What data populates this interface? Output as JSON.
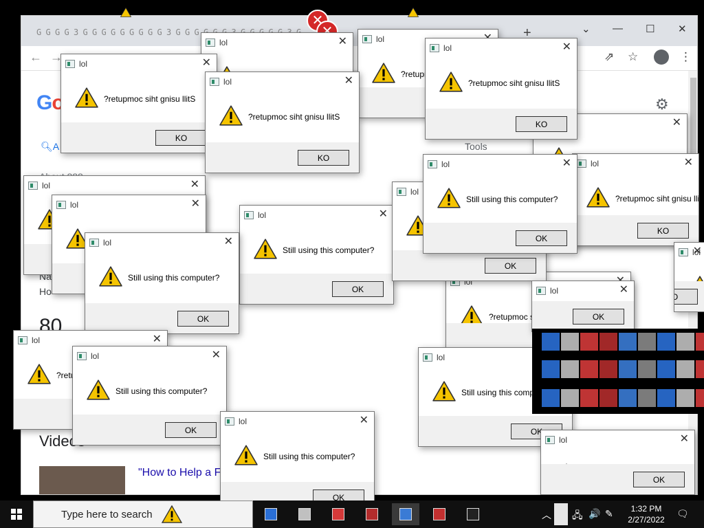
{
  "browser": {
    "tab_glyphs": [
      "G",
      "G",
      "G",
      "G",
      "3",
      "G",
      "G",
      "G",
      "G",
      "G",
      "G",
      "G",
      "G",
      "G",
      "3",
      "G",
      "G",
      "G",
      "G",
      "G",
      "G",
      "3",
      "G",
      "G",
      "G",
      "G",
      "G",
      "3",
      "G"
    ],
    "new_tab_glyph": "+",
    "minimize_glyph": "—",
    "maximize_glyph": "☐",
    "close_glyph": "✕",
    "back_glyph": "←",
    "forward_glyph": "→",
    "share_glyph": "⇗",
    "bookmark_glyph": "☆",
    "menu_glyph": "⋮",
    "logo_letters": [
      "G",
      "o"
    ],
    "search_tab_all": "A",
    "result_count": "About 888",
    "tools_label": "Tools",
    "snippet_ho": "Ho",
    "snippet_na": "Na",
    "big_number": "80",
    "videos_heading": "Videos",
    "video_title": "\"How to Help a Fr",
    "gear_glyph": "⚙"
  },
  "dialogs": [
    {
      "title": "lol",
      "message": "?retupmoc siht gnisu llitS",
      "button": "KO"
    },
    {
      "title": "lol",
      "message": "?retupmoc siht gnisu llitS",
      "button": "KO"
    },
    {
      "title": "lol",
      "message": "?retupmoc siht gnisu llitS",
      "button": "KO"
    },
    {
      "title": "lol",
      "message": "?retupmoc siht gnisu llitS",
      "button": "KO"
    },
    {
      "title": "lol",
      "message": "Still using this computer?",
      "button": "OK"
    },
    {
      "title": "lol",
      "message": "Still using this computer?",
      "button": "OK"
    },
    {
      "title": "lol",
      "message": "Still using this computer?",
      "button": "OK"
    },
    {
      "title": "lol",
      "message": "Still using this computer?",
      "button": "OK"
    },
    {
      "title": "lol",
      "message": "Still using this computer?",
      "button": "OK"
    },
    {
      "title": "lol",
      "message": "Still using this computer?",
      "button": "OK"
    },
    {
      "title": "lol",
      "message": "?retupmoc s",
      "button": "KO"
    },
    {
      "title": "lol",
      "message": "?retu",
      "button": "KO"
    }
  ],
  "close_glyph": "✕",
  "error_glyph": "✕",
  "taskbar": {
    "search_placeholder": "Type here to search",
    "time": "1:32 PM",
    "date": "2/27/2022",
    "chevron_glyph": "︿",
    "volume_glyph": "🔊",
    "pen_glyph": "✎",
    "notification_glyph": "🗨"
  }
}
